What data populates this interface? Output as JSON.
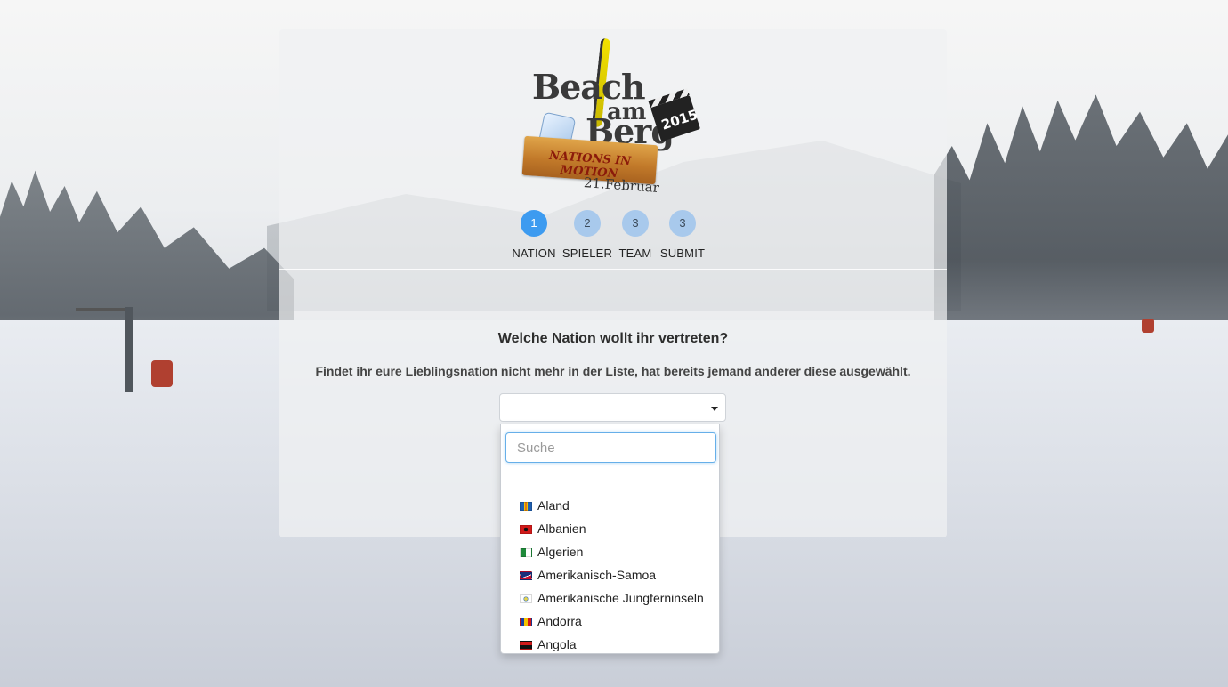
{
  "logo": {
    "word_beach": "Beach",
    "word_am": "am",
    "word_berg": "Berg",
    "year": "2015",
    "tagline": "NATIONS IN MOTION",
    "date": "21.Februar"
  },
  "steps": [
    {
      "number": "1",
      "label": "NATION",
      "active": true
    },
    {
      "number": "2",
      "label": "SPIELER",
      "active": false
    },
    {
      "number": "3",
      "label": "TEAM",
      "active": false
    },
    {
      "number": "3",
      "label": "SUBMIT",
      "active": false
    }
  ],
  "form": {
    "question": "Welche Nation wollt ihr vertreten?",
    "hint": "Findet ihr eure Lieblingsnation nicht mehr in der Liste, hat bereits jemand anderer diese ausgewählt.",
    "selected_value": ""
  },
  "dropdown": {
    "search_placeholder": "Suche",
    "options": [
      {
        "label": "Aland",
        "flag_colors": [
          "#1f5fb0",
          "#f2c500",
          "#d12a2a"
        ]
      },
      {
        "label": "Albanien",
        "flag_colors": [
          "#d21a1a",
          "#111111",
          "#d21a1a"
        ]
      },
      {
        "label": "Algerien",
        "flag_colors": [
          "#1f8a3a",
          "#ffffff",
          "#d21a1a"
        ]
      },
      {
        "label": "Amerikanisch-Samoa",
        "flag_colors": [
          "#1a2f7a",
          "#ffffff",
          "#c8102e"
        ]
      },
      {
        "label": "Amerikanische Jungferninseln",
        "flag_colors": [
          "#ffffff",
          "#e8d44a",
          "#4a7dbf"
        ]
      },
      {
        "label": "Andorra",
        "flag_colors": [
          "#1a3fa3",
          "#f4c400",
          "#d21a1a"
        ]
      },
      {
        "label": "Angola",
        "flag_colors": [
          "#d21a1a",
          "#111111",
          "#f4c400"
        ]
      }
    ]
  }
}
